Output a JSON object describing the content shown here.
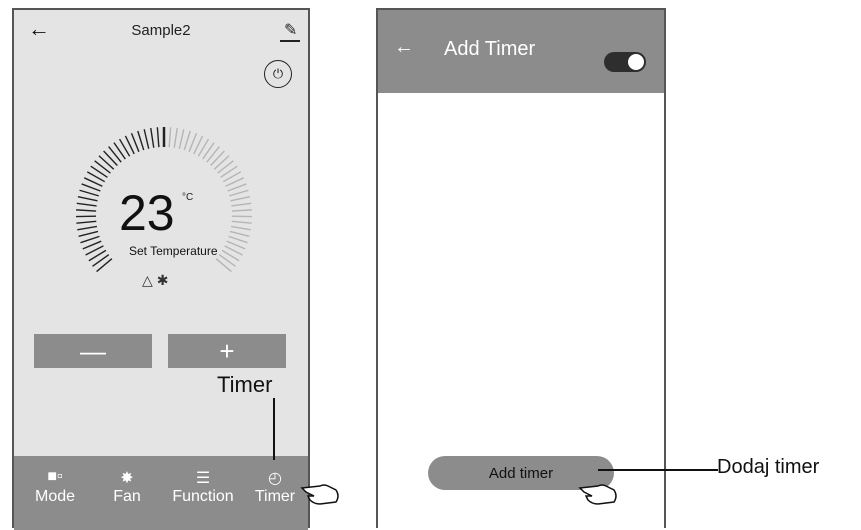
{
  "left_screen": {
    "title": "Sample2",
    "back_icon": "arrow-left-icon",
    "edit_icon": "pencil-icon",
    "power_icon": "power-icon",
    "temperature": {
      "value": "23",
      "unit": "°C",
      "label": "Set Temperature"
    },
    "mode_icons": [
      "recycle-icon",
      "fan-auto-icon"
    ],
    "minus_label": "—",
    "plus_label": "+",
    "nav": [
      {
        "label": "Mode",
        "icon": "mode-icon"
      },
      {
        "label": "Fan",
        "icon": "fan-icon"
      },
      {
        "label": "Function",
        "icon": "menu-icon"
      },
      {
        "label": "Timer",
        "icon": "clock-icon"
      }
    ]
  },
  "right_screen": {
    "title": "Add Timer",
    "back_icon": "arrow-left-icon",
    "toggle_state": "on",
    "add_timer_label": "Add timer"
  },
  "callouts": {
    "timer": "Timer",
    "dodaj": "Dodaj timer"
  },
  "colors": {
    "bar_gray": "#8c8c8c",
    "screen_bg": "#e4e4e4",
    "toggle_bg": "#2e2e2e"
  }
}
